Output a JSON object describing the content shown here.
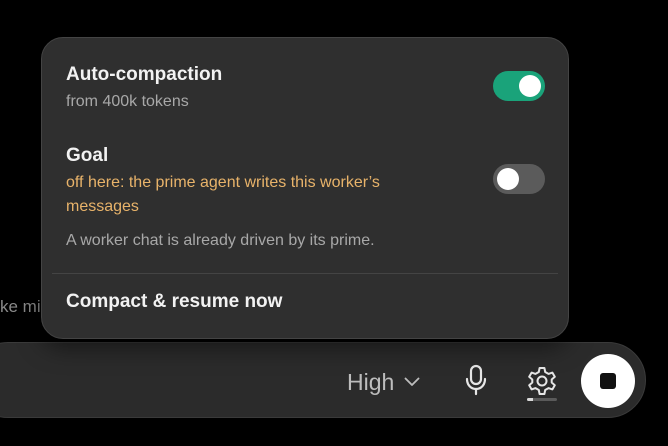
{
  "background": {
    "partial_text": "ke mi"
  },
  "popover": {
    "auto_compaction": {
      "title": "Auto-compaction",
      "subtitle": "from 400k tokens",
      "enabled": true
    },
    "goal": {
      "title": "Goal",
      "warning": "off here: the prime agent writes this worker’s messages",
      "note": "A worker chat is already driven by its prime.",
      "enabled": false
    },
    "action_label": "Compact & resume now"
  },
  "composer": {
    "model_level": "High",
    "icons": {
      "model_dropdown": "chevron-down-icon",
      "mic": "microphone-icon",
      "settings": "gear-icon",
      "stop": "stop-icon"
    },
    "settings_progress": 0.2
  },
  "colors": {
    "toggle_on": "#1aa37a",
    "toggle_off": "#5b5b5b",
    "warning_text": "#e8b36a",
    "popover_bg": "#2f2f2f",
    "composer_bg": "#2b2b2b"
  }
}
